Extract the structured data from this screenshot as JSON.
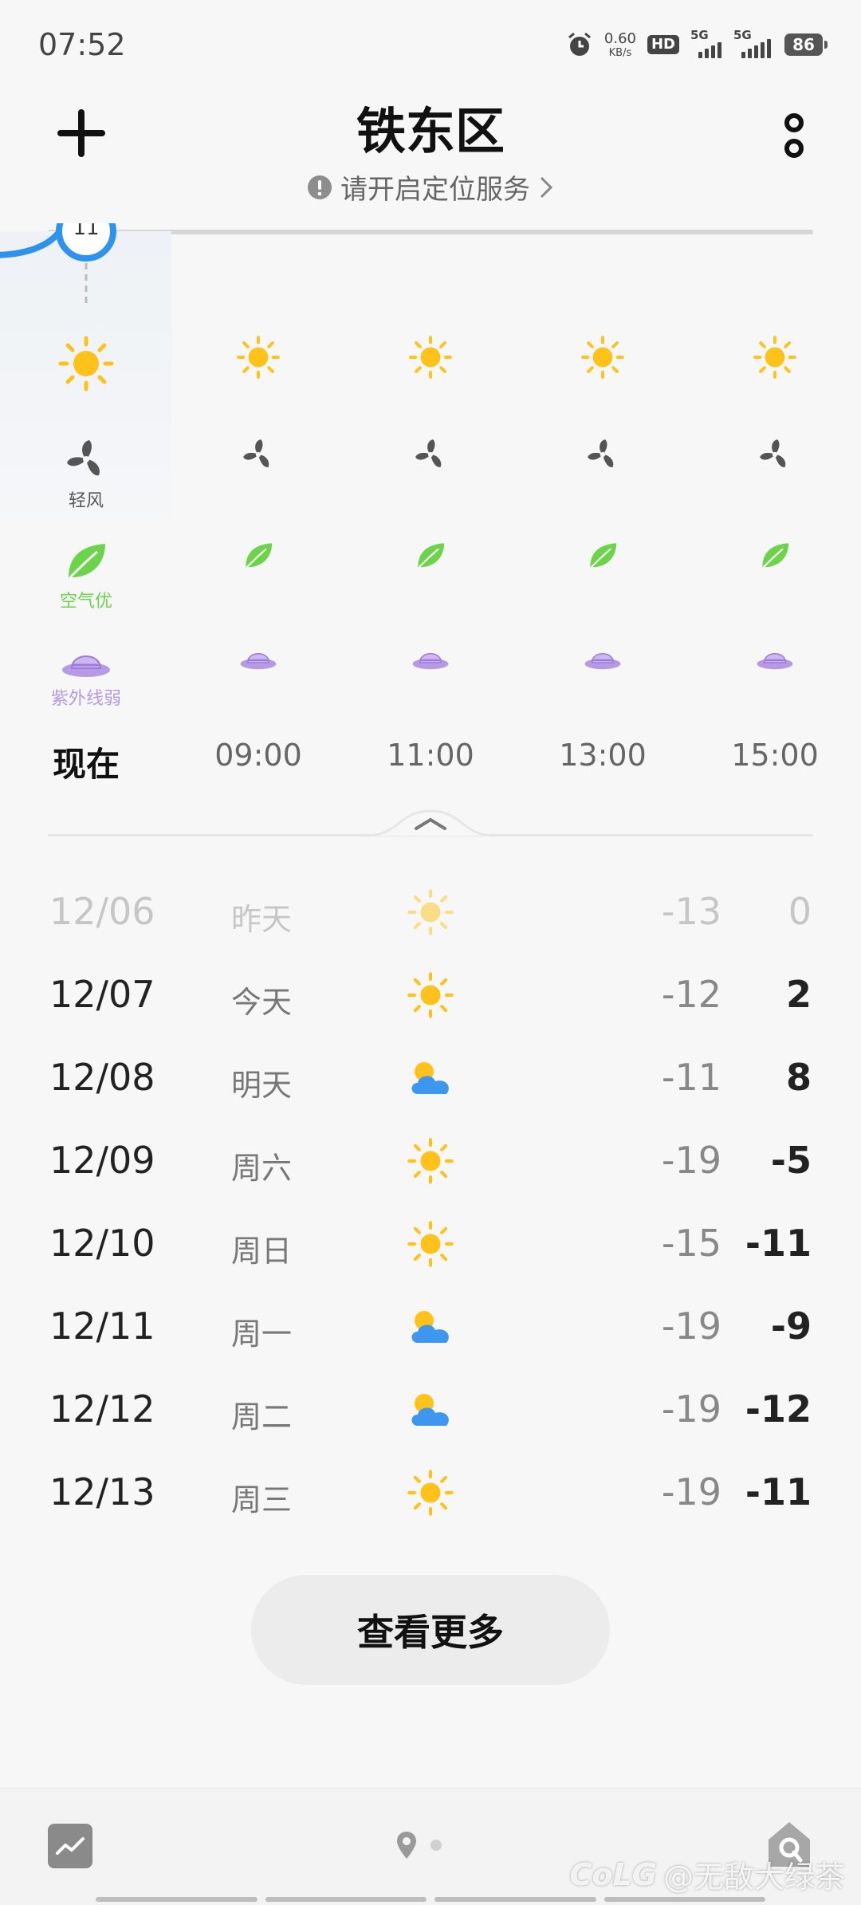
{
  "status_bar": {
    "time": "07:52",
    "net_speed": "0.60",
    "net_unit": "KB/s",
    "hd_label": "HD",
    "signal_1": "5G",
    "signal_2": "5G",
    "battery": "86"
  },
  "header": {
    "city": "铁东区",
    "location_hint": "请开启定位服务"
  },
  "hourly": {
    "hours": [
      {
        "label": "现在",
        "wind": "轻风",
        "air": "空气优",
        "uv": "紫外线弱",
        "now": true
      },
      {
        "label": "09:00",
        "wind": "",
        "air": "",
        "uv": ""
      },
      {
        "label": "11:00",
        "wind": "",
        "air": "",
        "uv": ""
      },
      {
        "label": "13:00",
        "wind": "",
        "air": "",
        "uv": ""
      },
      {
        "label": "15:00",
        "wind": "",
        "air": "",
        "uv": ""
      }
    ]
  },
  "daily": {
    "days": [
      {
        "date": "12/06",
        "weekday": "昨天",
        "icon": "sun-icon",
        "low": "-13",
        "high": "0",
        "past": true
      },
      {
        "date": "12/07",
        "weekday": "今天",
        "icon": "sun-icon",
        "low": "-12",
        "high": "2"
      },
      {
        "date": "12/08",
        "weekday": "明天",
        "icon": "partly-cloudy-icon",
        "low": "-11",
        "high": "8"
      },
      {
        "date": "12/09",
        "weekday": "周六",
        "icon": "sun-icon",
        "low": "-19",
        "high": "-5"
      },
      {
        "date": "12/10",
        "weekday": "周日",
        "icon": "sun-icon",
        "low": "-15",
        "high": "-11"
      },
      {
        "date": "12/11",
        "weekday": "周一",
        "icon": "partly-cloudy-icon",
        "low": "-19",
        "high": "-9"
      },
      {
        "date": "12/12",
        "weekday": "周二",
        "icon": "partly-cloudy-icon",
        "low": "-19",
        "high": "-12"
      },
      {
        "date": "12/13",
        "weekday": "周三",
        "icon": "sun-icon",
        "low": "-19",
        "high": "-11"
      }
    ],
    "more_label": "查看更多"
  },
  "watermark": {
    "logo": "CoLG",
    "text": "@无敌大绿茶"
  },
  "colors": {
    "sun": "#FFC21A",
    "wind": "#555555",
    "air": "#6CD44B",
    "uv": "#B79AE6",
    "cloud": "#3E97EE"
  }
}
